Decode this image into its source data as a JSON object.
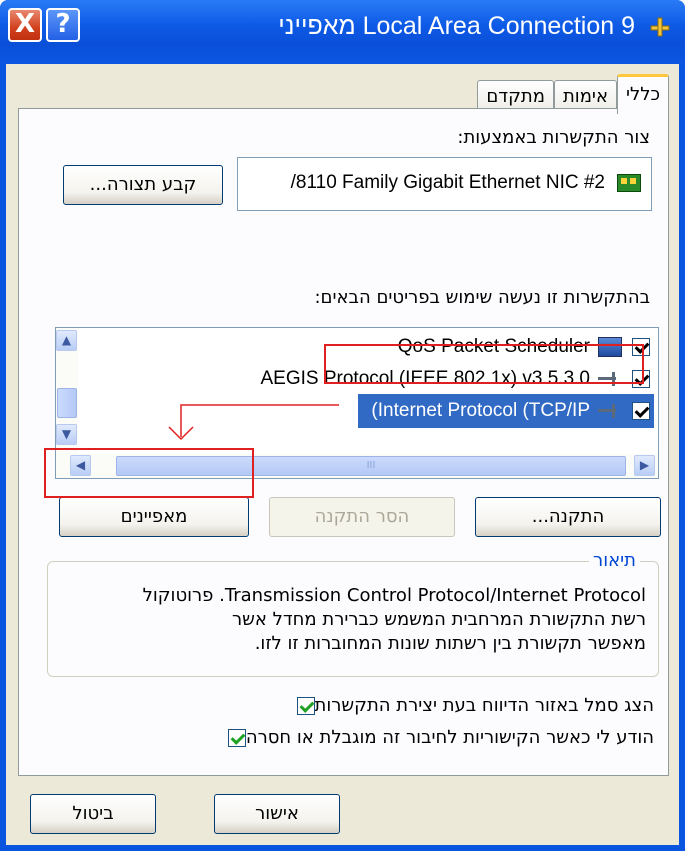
{
  "window": {
    "title": "Local Area Connection 9 מאפייני",
    "close_glyph": "X",
    "help_glyph": "?"
  },
  "tabs": [
    {
      "label": "כללי"
    },
    {
      "label": "אימות"
    },
    {
      "label": "מתקדם"
    }
  ],
  "connect_using": {
    "label": "צור התקשרות באמצעות:",
    "adapter": "/8110 Family Gigabit Ethernet NIC #2",
    "configure_button": "קבע תצורה..."
  },
  "items_section": {
    "label": "בהתקשרות זו נעשה שימוש בפריטים הבאים:",
    "items": [
      {
        "label": "QoS Packet Scheduler",
        "checked": true,
        "icon": "scheduler-icon"
      },
      {
        "label": "AEGIS Protocol (IEEE 802.1x) v3.5.3.0",
        "checked": true,
        "icon": "protocol-icon"
      },
      {
        "label": "(Internet Protocol (TCP/IP",
        "checked": true,
        "icon": "protocol-icon",
        "selected": true
      }
    ],
    "hscroll_grip": "III"
  },
  "buttons": {
    "install": "התקנה...",
    "uninstall": "הסר התקנה",
    "properties": "מאפיינים",
    "ok": "אישור",
    "cancel": "ביטול"
  },
  "description": {
    "legend": "תיאור",
    "line1": "Transmission Control Protocol/Internet Protocol. פרוטוקול",
    "line2": "רשת התקשורת המרחבית המשמש כברירת מחדל אשר",
    "line3": "מאפשר תקשורת בין רשתות שונות המחוברות זו לזו."
  },
  "options": [
    {
      "label": "הצג סמל באזור הדיווח בעת יצירת התקשרות",
      "checked": true
    },
    {
      "label": "הודע לי כאשר הקישוריות לחיבור זה מוגבלת או חסרה",
      "checked": true
    }
  ],
  "colors": {
    "title_bar": "#0a55e0",
    "selection": "#316ac5",
    "annotation_red": "#e02020",
    "legend_blue": "#0046d5"
  }
}
